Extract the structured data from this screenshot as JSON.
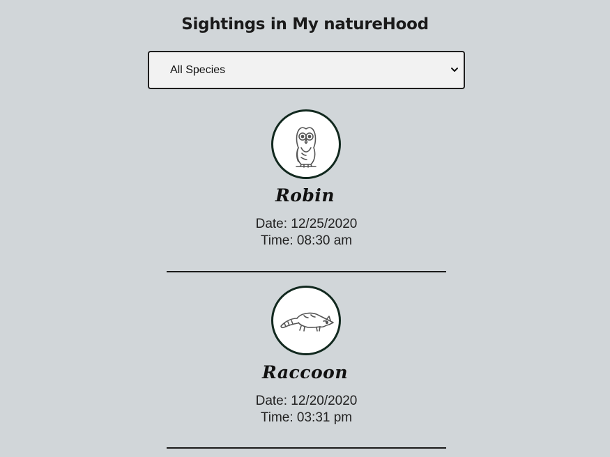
{
  "header": {
    "title": "Sightings in My natureHood"
  },
  "filter": {
    "selected": "All Species"
  },
  "sightings": [
    {
      "species": "Robin",
      "icon": "owl-icon",
      "date": "Date: 12/25/2020",
      "time": "Time: 08:30 am"
    },
    {
      "species": "Raccoon",
      "icon": "raccoon-icon",
      "date": "Date: 12/20/2020",
      "time": "Time: 03:31 pm"
    }
  ],
  "colors": {
    "background": "#d1d6d9",
    "avatar_border": "#12291f"
  }
}
